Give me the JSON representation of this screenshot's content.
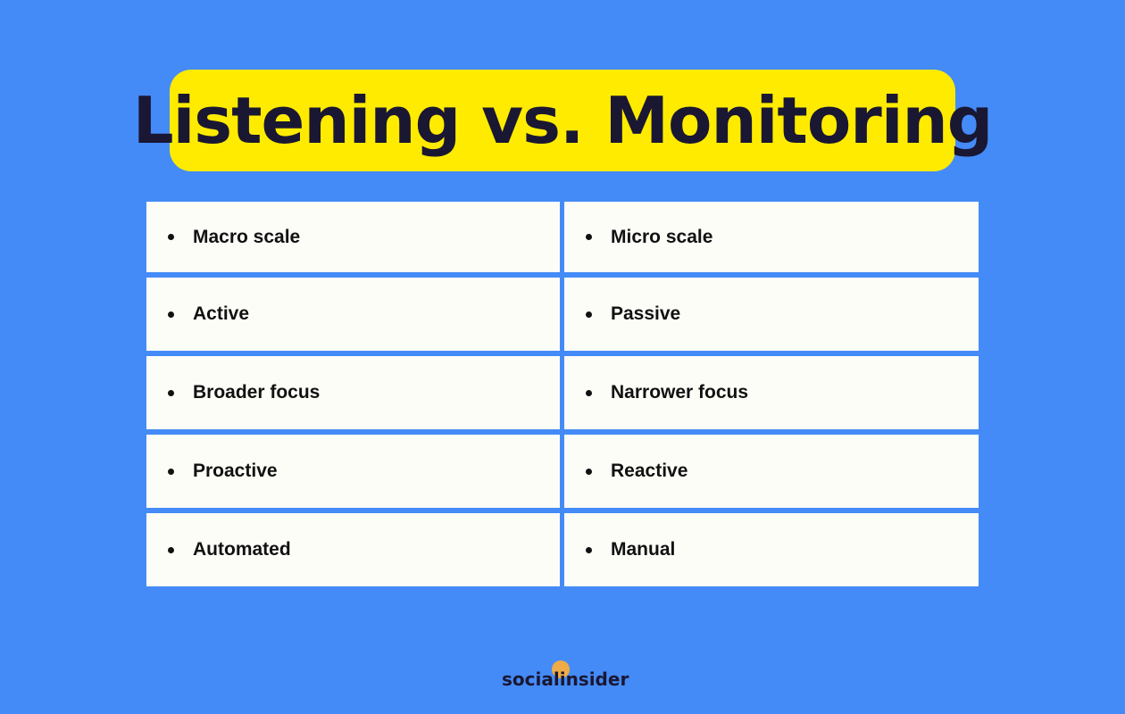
{
  "title": "Listening vs. Monitoring",
  "columns": {
    "left": [
      "Macro scale",
      "Active",
      "Broader focus",
      "Proactive",
      "Automated"
    ],
    "right": [
      "Micro scale",
      "Passive",
      "Narrower focus",
      "Reactive",
      "Manual"
    ]
  },
  "brand": {
    "name": "socialinsider"
  },
  "colors": {
    "background": "#448bf7",
    "title_highlight": "#ffeb00",
    "title_text": "#1a1733",
    "cell_bg": "#fdfdf8",
    "logo_dot": "#f9ad3c"
  }
}
